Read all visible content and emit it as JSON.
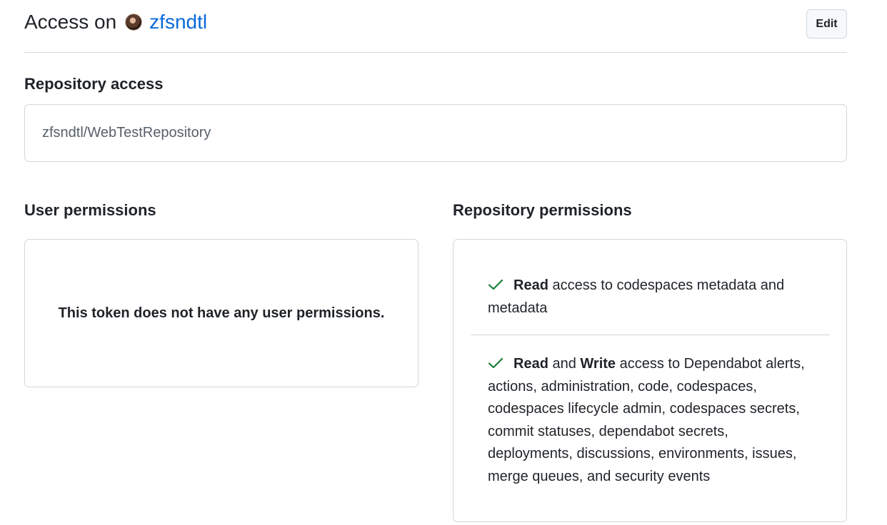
{
  "header": {
    "prefix": "Access on",
    "owner": "zfsndtl",
    "edit_label": "Edit"
  },
  "repository_access": {
    "title": "Repository access",
    "repos": [
      "zfsndtl/WebTestRepository"
    ]
  },
  "user_permissions": {
    "title": "User permissions",
    "empty_message": "This token does not have any user permissions."
  },
  "repository_permissions": {
    "title": "Repository permissions",
    "items": [
      {
        "icon": "check-icon",
        "level_read": "Read",
        "text": " access to codespaces metadata and metadata"
      },
      {
        "icon": "check-icon",
        "level_read": "Read",
        "joiner": " and ",
        "level_write": "Write",
        "text": " access to Dependabot alerts, actions, administration, code, codespaces, codespaces lifecycle admin, codespaces secrets, commit statuses, dependabot secrets, deployments, discussions, environments, issues, merge queues, and security events"
      }
    ]
  },
  "colors": {
    "link": "#0969da",
    "check": "#1a7f37",
    "border": "#d0d7de"
  }
}
